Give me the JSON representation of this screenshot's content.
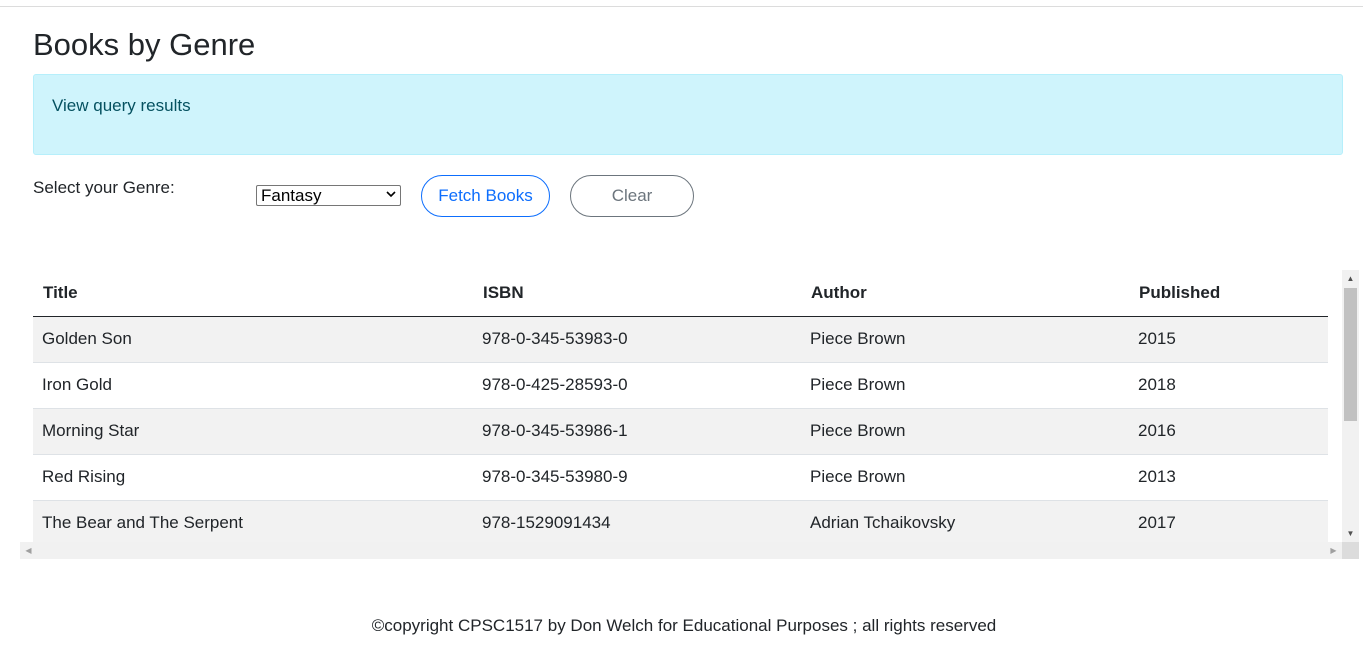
{
  "page": {
    "title": "Books by Genre"
  },
  "info": {
    "message": "View query results"
  },
  "form": {
    "genre_label": "Select your Genre:",
    "genre_selected": "Fantasy",
    "fetch_label": "Fetch Books",
    "clear_label": "Clear"
  },
  "table": {
    "headers": [
      "Title",
      "ISBN",
      "Author",
      "Published"
    ],
    "rows": [
      {
        "title": "Golden Son",
        "isbn": "978-0-345-53983-0",
        "author": "Piece Brown",
        "published": "2015"
      },
      {
        "title": "Iron Gold",
        "isbn": "978-0-425-28593-0",
        "author": "Piece Brown",
        "published": "2018"
      },
      {
        "title": "Morning Star",
        "isbn": "978-0-345-53986-1",
        "author": "Piece Brown",
        "published": "2016"
      },
      {
        "title": "Red Rising",
        "isbn": "978-0-345-53980-9",
        "author": "Piece Brown",
        "published": "2013"
      },
      {
        "title": "The Bear and The Serpent",
        "isbn": "978-1529091434",
        "author": "Adrian Tchaikovsky",
        "published": "2017"
      }
    ]
  },
  "footer": {
    "text": "©copyright CPSC1517 by Don Welch for Educational Purposes ; all rights reserved"
  },
  "colors": {
    "info_bg": "#cff4fc",
    "info_text": "#055160",
    "primary": "#0d6efd",
    "secondary": "#6c757d",
    "striped_row": "#f2f2f2"
  },
  "icons": {
    "select_chevron": "chevron-down-icon",
    "scroll_up": "scroll-up-arrow-icon",
    "scroll_down": "scroll-down-arrow-icon",
    "scroll_left": "scroll-left-arrow-icon",
    "scroll_right": "scroll-right-arrow-icon"
  }
}
